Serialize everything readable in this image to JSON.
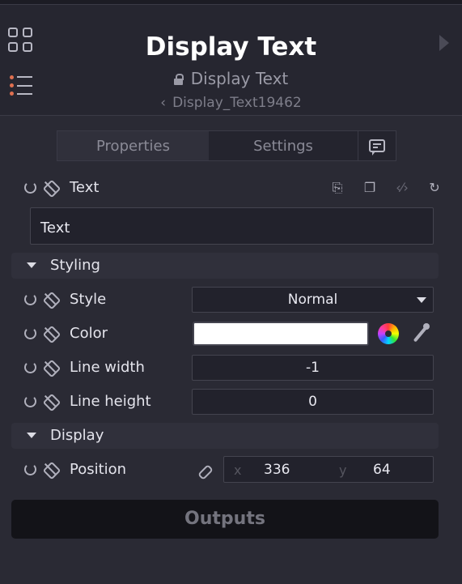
{
  "header": {
    "title": "Display Text",
    "subtitle": "Display Text",
    "breadcrumb": "Display_Text19462"
  },
  "tabs": [
    {
      "label": "Properties",
      "active": true
    },
    {
      "label": "Settings",
      "active": false
    }
  ],
  "text_property": {
    "label": "Text",
    "value": "Text"
  },
  "sections": {
    "styling": "Styling",
    "display": "Display"
  },
  "styling": {
    "style": {
      "label": "Style",
      "value": "Normal"
    },
    "color": {
      "label": "Color",
      "value": "#ffffff"
    },
    "line_width": {
      "label": "Line width",
      "value": "-1"
    },
    "line_height": {
      "label": "Line height",
      "value": "0"
    }
  },
  "display": {
    "position": {
      "label": "Position",
      "x_label": "x",
      "x": "336",
      "y_label": "y",
      "y": "64"
    }
  },
  "outputs_label": "Outputs",
  "icons": [
    "grid-icon",
    "list-icon",
    "collapse-arrow-icon",
    "lock-icon",
    "chevron-left-icon",
    "chat-icon",
    "reset-icon",
    "unlink-icon",
    "color-wheel-icon",
    "eyedropper-icon",
    "link-icon"
  ]
}
